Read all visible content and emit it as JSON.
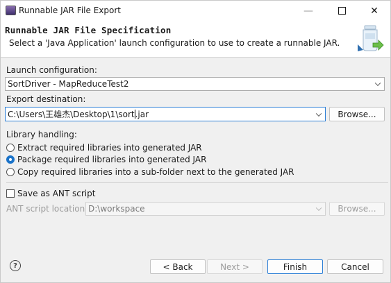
{
  "window": {
    "title": "Runnable JAR File Export",
    "controls": {
      "minimize": "—",
      "maximize": "",
      "close": "✕"
    }
  },
  "banner": {
    "title": "Runnable JAR File Specification",
    "description": "Select a 'Java Application' launch configuration to use to create a runnable JAR."
  },
  "launch": {
    "label": "Launch configuration:",
    "value": "SortDriver - MapReduceTest2"
  },
  "export": {
    "label": "Export destination:",
    "value_before_caret": "C:\\Users\\王雄杰\\Desktop\\1\\sort",
    "value_after_caret": ".jar",
    "browse_label": "Browse..."
  },
  "library": {
    "label": "Library handling:",
    "options": [
      {
        "label": "Extract required libraries into generated JAR",
        "checked": false
      },
      {
        "label": "Package required libraries into generated JAR",
        "checked": true
      },
      {
        "label": "Copy required libraries into a sub-folder next to the generated JAR",
        "checked": false
      }
    ]
  },
  "ant": {
    "checkbox_label": "Save as ANT script",
    "checked": false,
    "location_label": "ANT script location:",
    "location_value": "D:\\workspace",
    "browse_label": "Browse..."
  },
  "footer": {
    "help": "?",
    "back": "< Back",
    "next": "Next >",
    "finish": "Finish",
    "cancel": "Cancel"
  },
  "colors": {
    "accent": "#2d7fd6",
    "radio_selected": "#1a73c9",
    "dialog_bg": "#f0f0f0"
  }
}
